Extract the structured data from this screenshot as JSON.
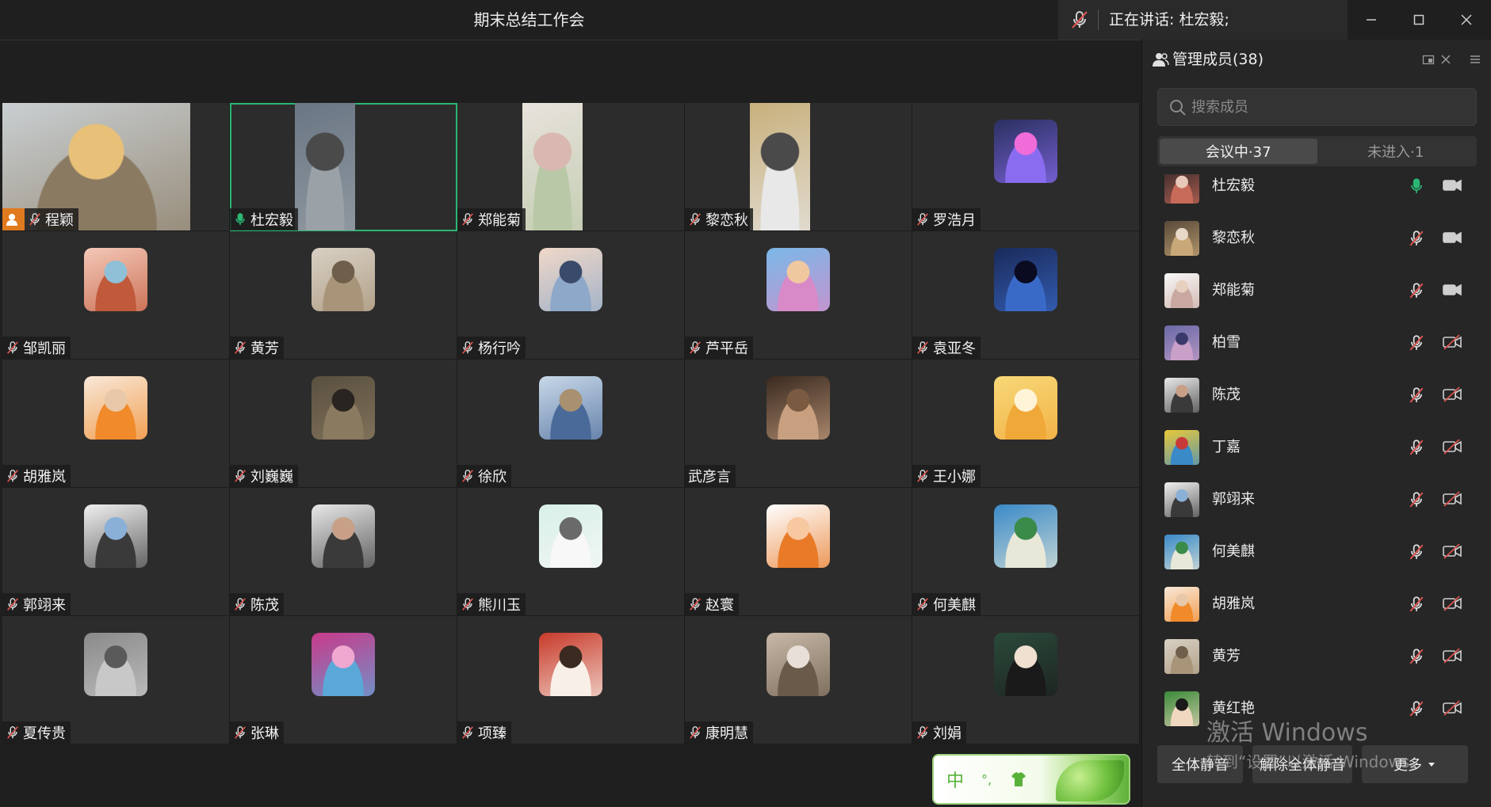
{
  "window": {
    "title": "期末总结工作会",
    "speaking_text": "正在讲话: 杜宏毅;",
    "controls": [
      "minimize-icon",
      "maximize-icon",
      "close-icon"
    ]
  },
  "grid": {
    "tiles": [
      {
        "name": "程颖",
        "kind": "video",
        "mic": "off",
        "host": true,
        "active": false,
        "colors": [
          "#c9cfd2",
          "#8a7a62",
          "#e8c078"
        ]
      },
      {
        "name": "杜宏毅",
        "kind": "video",
        "mic": "on",
        "host": false,
        "active": true,
        "colors": [
          "#6a7684",
          "#9aa2a8",
          "#4a4a4a"
        ]
      },
      {
        "name": "郑能菊",
        "kind": "video",
        "mic": "off",
        "host": false,
        "active": false,
        "colors": [
          "#e8e2dc",
          "#b9c8a6",
          "#d8b8b0"
        ]
      },
      {
        "name": "黎恋秋",
        "kind": "video",
        "mic": "off",
        "host": false,
        "active": false,
        "colors": [
          "#c8b07c",
          "#e8e8e8",
          "#4a4a4a"
        ]
      },
      {
        "name": "罗浩月",
        "kind": "avatar",
        "mic": "off",
        "host": false,
        "active": false,
        "colors": [
          "#2a3060",
          "#8a6cf0",
          "#f06cd8"
        ]
      },
      {
        "name": "邹凯丽",
        "kind": "avatar",
        "mic": "off",
        "colors": [
          "#f4c8b8",
          "#c05a3a",
          "#8fc0d8"
        ]
      },
      {
        "name": "黄芳",
        "kind": "avatar",
        "mic": "off",
        "colors": [
          "#d8d0c4",
          "#a89478",
          "#6e5e4a"
        ]
      },
      {
        "name": "杨行吟",
        "kind": "avatar",
        "mic": "off",
        "colors": [
          "#f0d8c8",
          "#8da8c8",
          "#3a4a6a"
        ]
      },
      {
        "name": "芦平岳",
        "kind": "avatar",
        "mic": "off",
        "colors": [
          "#7ab8e8",
          "#d88ac8",
          "#f0c8a0"
        ]
      },
      {
        "name": "袁亚冬",
        "kind": "avatar",
        "mic": "off",
        "colors": [
          "#1a2a5a",
          "#3a6ac8",
          "#0a0a20"
        ]
      },
      {
        "name": "胡雅岚",
        "kind": "avatar",
        "mic": "off",
        "colors": [
          "#f8e8d8",
          "#f08a2a",
          "#e8c8a8"
        ]
      },
      {
        "name": "刘巍巍",
        "kind": "avatar",
        "mic": "off",
        "colors": [
          "#5a5040",
          "#8a7a60",
          "#2a2420"
        ]
      },
      {
        "name": "徐欣",
        "kind": "avatar",
        "mic": "off",
        "colors": [
          "#c8d8e8",
          "#4a6a9a",
          "#a89070"
        ]
      },
      {
        "name": "武彦言",
        "kind": "avatar",
        "mic": "none",
        "colors": [
          "#3a2a20",
          "#c8a080",
          "#7a5a40"
        ]
      },
      {
        "name": "王小娜",
        "kind": "avatar",
        "mic": "off",
        "colors": [
          "#f8d878",
          "#f0a838",
          "#fff4d8"
        ]
      },
      {
        "name": "郭翊来",
        "kind": "avatar",
        "mic": "off",
        "colors": [
          "#f0f0f0",
          "#3a3a3a",
          "#8ab0d8"
        ]
      },
      {
        "name": "陈茂",
        "kind": "avatar",
        "mic": "off",
        "colors": [
          "#e8e8e8",
          "#3a3a3a",
          "#c8a088"
        ]
      },
      {
        "name": "熊川玉",
        "kind": "avatar",
        "mic": "off",
        "colors": [
          "#d8f0e8",
          "#f8f8f8",
          "#6a6a6a"
        ]
      },
      {
        "name": "赵寰",
        "kind": "avatar",
        "mic": "off",
        "colors": [
          "#ffffff",
          "#e87a28",
          "#f8c8a0"
        ]
      },
      {
        "name": "何美麒",
        "kind": "avatar",
        "mic": "off",
        "colors": [
          "#3a8ac8",
          "#e8e8d8",
          "#3a8a4a"
        ]
      },
      {
        "name": "夏传贵",
        "kind": "avatar",
        "mic": "off",
        "colors": [
          "#8a8a8a",
          "#c8c8c8",
          "#5a5a5a"
        ]
      },
      {
        "name": "张琳",
        "kind": "avatar",
        "mic": "off",
        "colors": [
          "#c83a8a",
          "#5aa8d8",
          "#f0a8d0"
        ]
      },
      {
        "name": "项臻",
        "kind": "avatar",
        "mic": "off",
        "colors": [
          "#c83a2a",
          "#f8f0e8",
          "#3a2a20"
        ]
      },
      {
        "name": "康明慧",
        "kind": "avatar",
        "mic": "off",
        "colors": [
          "#c8b8a8",
          "#6a5a4a",
          "#e8e0d8"
        ]
      },
      {
        "name": "刘娟",
        "kind": "avatar",
        "mic": "off",
        "colors": [
          "#2a4a3a",
          "#1a1a1a",
          "#f0e0d0"
        ]
      }
    ]
  },
  "ime": {
    "label": "中",
    "punct": "°,",
    "shirt_icon": "shirt-icon"
  },
  "panel": {
    "title": "管理成员(38)",
    "search_placeholder": "搜索成员",
    "tabs": [
      {
        "label": "会议中·37",
        "active": true
      },
      {
        "label": "未进入·1",
        "active": false
      }
    ],
    "members": [
      {
        "name": "杜宏毅",
        "mic": "on",
        "cam": "on",
        "colors": [
          "#3a2a2a",
          "#c86a5a",
          "#e8c8b8"
        ]
      },
      {
        "name": "黎恋秋",
        "mic": "off",
        "cam": "on",
        "colors": [
          "#5a4a3a",
          "#c8a878",
          "#e8d8c8"
        ]
      },
      {
        "name": "郑能菊",
        "mic": "off",
        "cam": "on",
        "colors": [
          "#f8f8f8",
          "#c8a8a0",
          "#e8d0c0"
        ]
      },
      {
        "name": "柏雪",
        "mic": "off",
        "cam": "off",
        "colors": [
          "#6a6aa8",
          "#c8a0c8",
          "#3a3a6a"
        ]
      },
      {
        "name": "陈茂",
        "mic": "off",
        "cam": "off",
        "colors": [
          "#e8e8e8",
          "#3a3a3a",
          "#c8a088"
        ]
      },
      {
        "name": "丁嘉",
        "mic": "off",
        "cam": "off",
        "colors": [
          "#e8c83a",
          "#3a8ac8",
          "#c83a3a"
        ]
      },
      {
        "name": "郭翊来",
        "mic": "off",
        "cam": "off",
        "colors": [
          "#f0f0f0",
          "#3a3a3a",
          "#8ab0d8"
        ]
      },
      {
        "name": "何美麒",
        "mic": "off",
        "cam": "off",
        "colors": [
          "#3a8ac8",
          "#e8e8d8",
          "#3a8a4a"
        ]
      },
      {
        "name": "胡雅岚",
        "mic": "off",
        "cam": "off",
        "colors": [
          "#f8e8d8",
          "#f08a2a",
          "#e8c8a8"
        ]
      },
      {
        "name": "黄芳",
        "mic": "off",
        "cam": "off",
        "colors": [
          "#d8d0c4",
          "#a89478",
          "#6e5e4a"
        ]
      },
      {
        "name": "黄红艳",
        "mic": "off",
        "cam": "off",
        "colors": [
          "#3a8a3a",
          "#f0d8c0",
          "#1a1a1a"
        ]
      }
    ],
    "buttons": {
      "mute_all": "全体静音",
      "unmute_all": "解除全体静音",
      "more": "更多"
    }
  },
  "watermark": {
    "line1": "激活 Windows",
    "line2": "转到“设置”以激活 Windows。"
  },
  "colors": {
    "background": "#1f1f1f",
    "tile": "#2c2c2c",
    "active_border": "#2bb673",
    "mic_on": "#2bb673",
    "mic_off": "#d9534f",
    "host_badge": "#e07a1f"
  }
}
